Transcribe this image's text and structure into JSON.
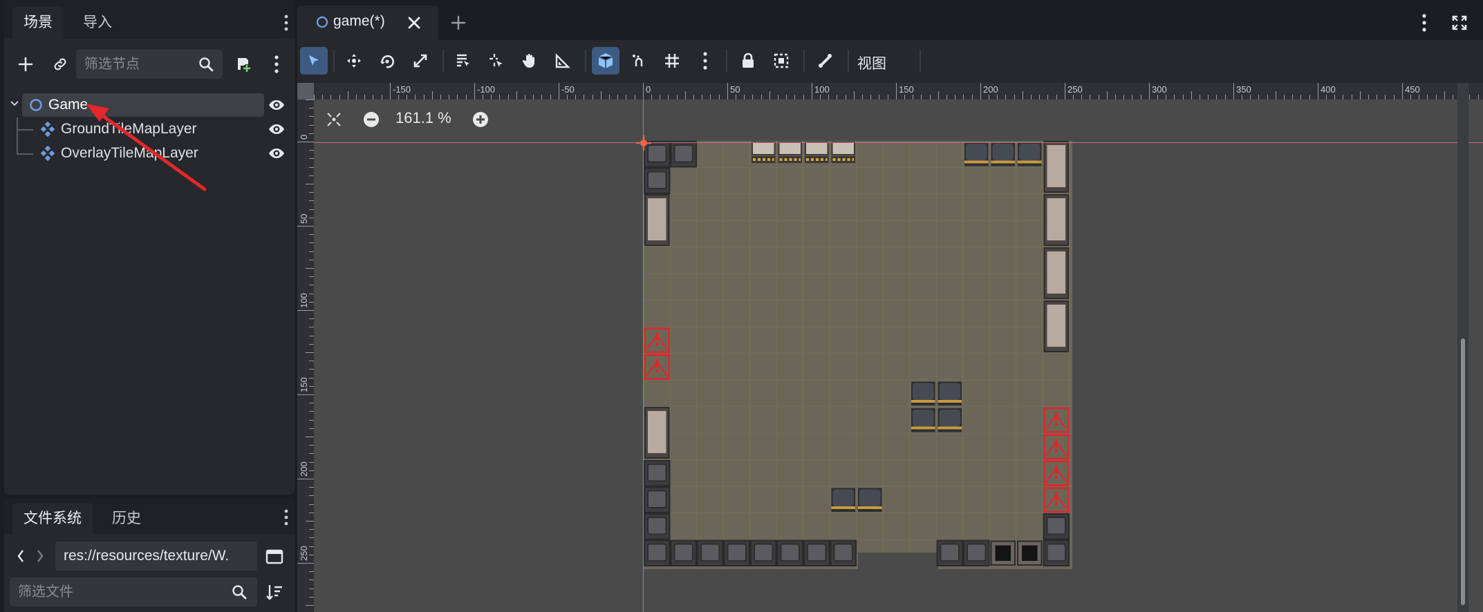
{
  "scene_dock": {
    "tabs": [
      {
        "label": "场景"
      },
      {
        "label": "导入"
      }
    ],
    "filter_placeholder": "筛选节点",
    "tree": [
      {
        "name": "Game",
        "icon": "node2d-circle-icon",
        "depth": 0,
        "selected": true
      },
      {
        "name": "GroundTileMapLayer",
        "icon": "tilemap-layer-icon",
        "depth": 1
      },
      {
        "name": "OverlayTileMapLayer",
        "icon": "tilemap-layer-icon",
        "depth": 1
      }
    ]
  },
  "filesystem_dock": {
    "tabs": [
      {
        "label": "文件系统"
      },
      {
        "label": "历史"
      }
    ],
    "path": "res://resources/texture/W.",
    "filter_placeholder": "筛选文件"
  },
  "editor": {
    "doc_tab_title": "game(*)",
    "toolbar": {
      "view_label": "视图"
    },
    "zoom": "161.1 %",
    "ruler_h_labels": [
      "-150",
      "-100",
      "-50",
      "0",
      "50",
      "100",
      "150",
      "200",
      "250",
      "300",
      "350",
      "400",
      "450"
    ],
    "ruler_v_labels": [
      "0",
      "50",
      "100",
      "150",
      "200",
      "250"
    ]
  },
  "colors": {
    "accent": "#5f8fd7",
    "selection_bg": "#3d4047",
    "arrow": "#e3272a",
    "floor": "#6c6658",
    "origin_line_h": "#c86a84",
    "origin_line_v": "#7fa04a"
  }
}
